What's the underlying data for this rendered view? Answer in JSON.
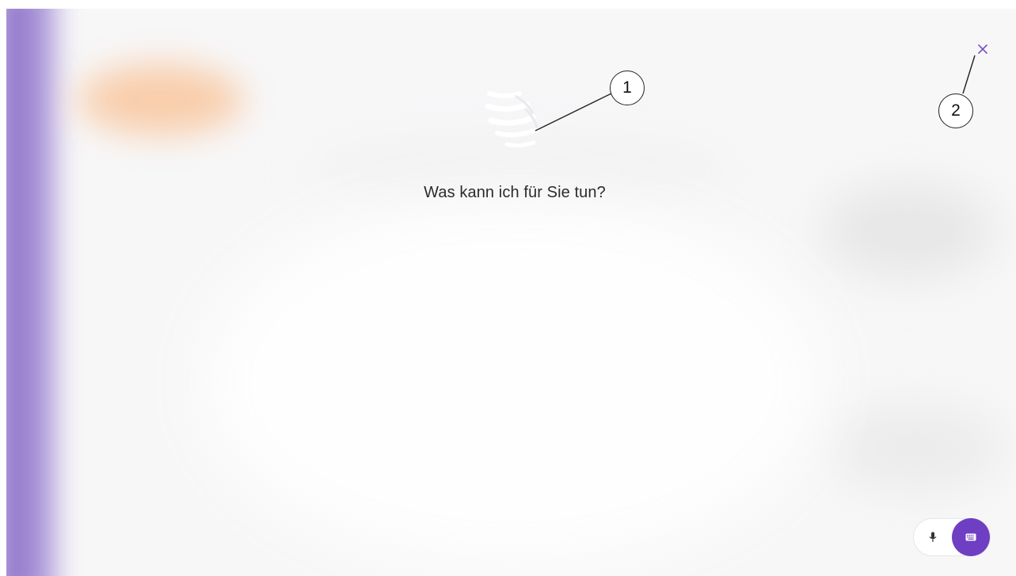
{
  "assistant": {
    "prompt": "Was kann ich für Sie tun?",
    "logo_icon": "assistant-wave-icon",
    "close_icon": "close-icon",
    "accent_color": "#6e3fc2"
  },
  "callouts": {
    "one": "1",
    "two": "2"
  },
  "input_controls": {
    "mic_icon": "microphone-icon",
    "keyboard_icon": "keyboard-icon"
  }
}
